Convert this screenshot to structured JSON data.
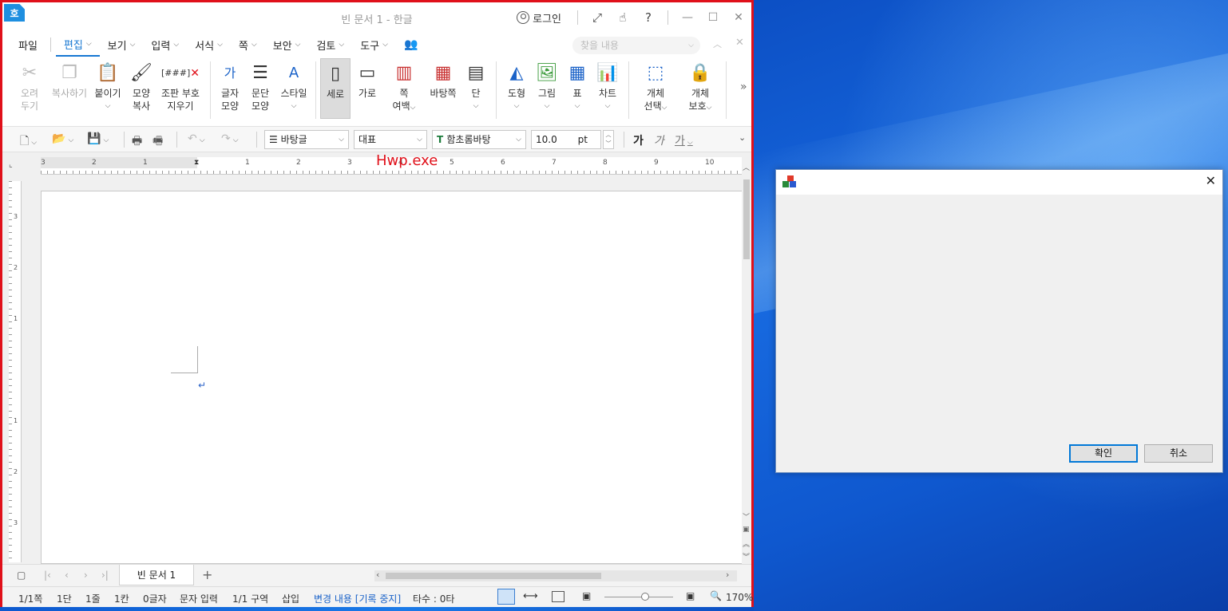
{
  "window": {
    "title": "빈 문서 1 - 한글",
    "app_badge": "호",
    "login": "로그인",
    "help": "?"
  },
  "menu": {
    "items": [
      {
        "label": "파일"
      },
      {
        "label": "편집"
      },
      {
        "label": "보기"
      },
      {
        "label": "입력"
      },
      {
        "label": "서식"
      },
      {
        "label": "쪽"
      },
      {
        "label": "보안"
      },
      {
        "label": "검토"
      },
      {
        "label": "도구"
      }
    ],
    "search_placeholder": "찾을 내용"
  },
  "ribbon": {
    "cut": "오려\n두기",
    "copy": "복사하기",
    "paste": "붙이기",
    "format_copy_1": "모양",
    "format_copy_2": "복사",
    "clear_code_icon": "[###]",
    "clear_code_1": "조판 부호",
    "clear_code_2": "지우기",
    "char_shape_1": "글자",
    "char_shape_2": "모양",
    "para_shape_1": "문단",
    "para_shape_2": "모양",
    "style": "스타일",
    "portrait": "세로",
    "landscape": "가로",
    "margin_1": "쪽",
    "margin_2": "여백",
    "background_page": "바탕쪽",
    "columns": "단",
    "shape": "도형",
    "picture": "그림",
    "table": "표",
    "chart": "차트",
    "select_obj_1": "개체",
    "select_obj_2": "선택",
    "protect_obj_1": "개체",
    "protect_obj_2": "보호"
  },
  "toolbar": {
    "style_value": "바탕글",
    "lang_value": "대표",
    "font_value": "함초롬바탕",
    "size_value": "10.0",
    "size_unit": "pt",
    "bold": "가",
    "italic": "가",
    "underline": "가"
  },
  "ruler": {
    "h_ticks": [
      "3",
      "2",
      "1",
      "1",
      "2",
      "3",
      "4",
      "5",
      "6",
      "7",
      "8",
      "9",
      "10"
    ],
    "v_ticks": [
      "3",
      "2",
      "1",
      "1",
      "2",
      "3"
    ],
    "exe_label": "Hwp.exe"
  },
  "tabs": {
    "doc_tab": "빈 문서 1",
    "add": "+"
  },
  "status": {
    "page": "1/1쪽",
    "column": "1단",
    "line": "1줄",
    "char_col": "1칸",
    "chars": "0글자",
    "input_mode": "문자 입력",
    "section": "1/1 구역",
    "insert": "삽입",
    "track_changes": "변경 내용 [기록 중지]",
    "typing": "타수 : 0타",
    "zoom": "170%"
  },
  "dialog": {
    "ok": "확인",
    "cancel": "취소"
  }
}
